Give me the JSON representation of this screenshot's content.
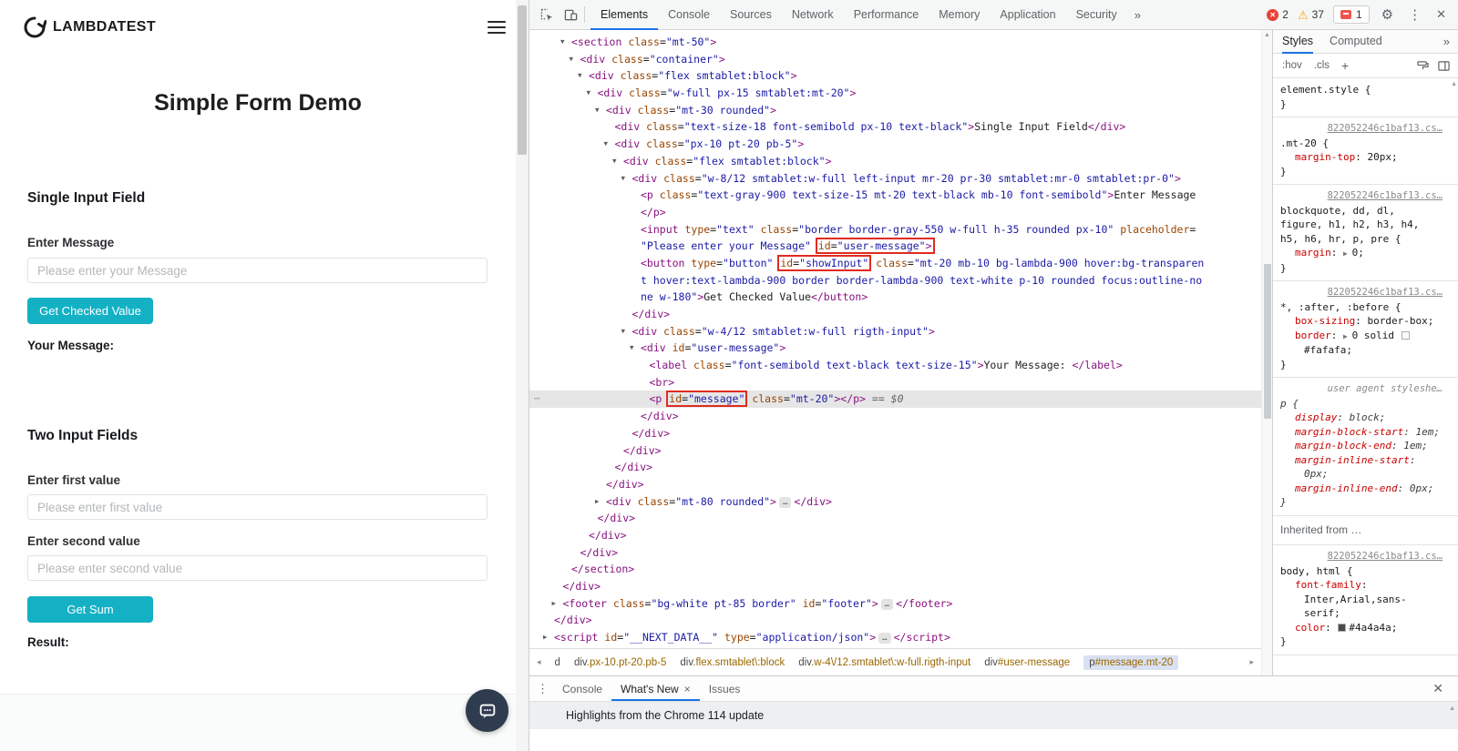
{
  "icons": {
    "gear": "⚙",
    "kebab": "⋮",
    "close": "✕",
    "more_tabs": "»",
    "crumb_left": "◂",
    "crumb_right": "▸",
    "scroll_up": "▲",
    "drawer_menu": "⋮",
    "error_x": "✕",
    "warning": "⚠"
  },
  "page": {
    "logo_text": "LAMBDATEST",
    "title": "Simple Form Demo",
    "section1": {
      "heading": "Single Input Field",
      "label": "Enter Message",
      "placeholder": "Please enter your Message",
      "button": "Get Checked Value",
      "result_label": "Your Message:"
    },
    "section2": {
      "heading": "Two Input Fields",
      "label1": "Enter first value",
      "placeholder1": "Please enter first value",
      "label2": "Enter second value",
      "placeholder2": "Please enter second value",
      "button": "Get Sum",
      "result_label": "Result:"
    }
  },
  "devtools": {
    "toolbar": {
      "tabs": [
        "Elements",
        "Console",
        "Sources",
        "Network",
        "Performance",
        "Memory",
        "Application",
        "Security"
      ],
      "selected_tab": "Elements",
      "errors": "2",
      "warnings": "37",
      "issues": "1"
    },
    "elements": {
      "rows": [
        {
          "l": 2,
          "ar": "v",
          "t": [
            [
              "<section ",
              "g"
            ],
            [
              "class",
              "a"
            ],
            [
              "=",
              "p"
            ],
            [
              "\"mt-50\"",
              "v"
            ],
            [
              ">",
              "g"
            ]
          ]
        },
        {
          "l": 3,
          "ar": "v",
          "t": [
            [
              "<div ",
              "g"
            ],
            [
              "class",
              "a"
            ],
            [
              "=",
              "p"
            ],
            [
              "\"container\"",
              "v"
            ],
            [
              ">",
              "g"
            ]
          ]
        },
        {
          "l": 4,
          "ar": "v",
          "t": [
            [
              "<div ",
              "g"
            ],
            [
              "class",
              "a"
            ],
            [
              "=",
              "p"
            ],
            [
              "\"flex smtablet:block\"",
              "v"
            ],
            [
              ">",
              "g"
            ]
          ]
        },
        {
          "l": 5,
          "ar": "v",
          "t": [
            [
              "<div ",
              "g"
            ],
            [
              "class",
              "a"
            ],
            [
              "=",
              "p"
            ],
            [
              "\"w-full px-15 smtablet:mt-20\"",
              "v"
            ],
            [
              ">",
              "g"
            ]
          ]
        },
        {
          "l": 6,
          "ar": "v",
          "t": [
            [
              "<div ",
              "g"
            ],
            [
              "class",
              "a"
            ],
            [
              "=",
              "p"
            ],
            [
              "\"mt-30 rounded\"",
              "v"
            ],
            [
              ">",
              "g"
            ]
          ]
        },
        {
          "l": 7,
          "t": [
            [
              "<div ",
              "g"
            ],
            [
              "class",
              "a"
            ],
            [
              "=",
              "p"
            ],
            [
              "\"text-size-18 font-semibold px-10 text-black\"",
              "v"
            ],
            [
              ">",
              "g"
            ],
            [
              "Single Input Field",
              "p"
            ],
            [
              "</div>",
              "g"
            ]
          ]
        },
        {
          "l": 7,
          "ar": "v",
          "t": [
            [
              "<div ",
              "g"
            ],
            [
              "class",
              "a"
            ],
            [
              "=",
              "p"
            ],
            [
              "\"px-10 pt-20 pb-5\"",
              "v"
            ],
            [
              ">",
              "g"
            ]
          ]
        },
        {
          "l": 8,
          "ar": "v",
          "t": [
            [
              "<div ",
              "g"
            ],
            [
              "class",
              "a"
            ],
            [
              "=",
              "p"
            ],
            [
              "\"flex smtablet:block\"",
              "v"
            ],
            [
              ">",
              "g"
            ]
          ]
        },
        {
          "l": 9,
          "ar": "v",
          "t": [
            [
              "<div ",
              "g"
            ],
            [
              "class",
              "a"
            ],
            [
              "=",
              "p"
            ],
            [
              "\"w-8/12 smtablet:w-full left-input mr-20 pr-30 smtablet:mr-0 smtablet:pr-0\"",
              "v"
            ],
            [
              ">",
              "g"
            ]
          ]
        },
        {
          "l": 10,
          "t": [
            [
              "<p ",
              "g"
            ],
            [
              "class",
              "a"
            ],
            [
              "=",
              "p"
            ],
            [
              "\"text-gray-900 text-size-15 mt-20 text-black mb-10 font-semibold\"",
              "v"
            ],
            [
              ">",
              "g"
            ],
            [
              "Enter Message",
              "p"
            ]
          ]
        },
        {
          "l": 10,
          "t": [
            [
              "</p>",
              "g"
            ]
          ]
        },
        {
          "l": 10,
          "t": [
            [
              "<input ",
              "g"
            ],
            [
              "type",
              "a"
            ],
            [
              "=",
              "p"
            ],
            [
              "\"text\" ",
              "v"
            ],
            [
              "class",
              "a"
            ],
            [
              "=",
              "p"
            ],
            [
              "\"border border-gray-550 w-full h-35 rounded px-10\" ",
              "v"
            ],
            [
              "placeholder",
              "a"
            ],
            [
              "=",
              "p"
            ]
          ]
        },
        {
          "l": 10,
          "t": [
            [
              "\"Please enter your Message\" ",
              "v"
            ],
            {
              "b": [
                [
                  "id",
                  "a"
                ],
                [
                  "=",
                  "p"
                ],
                [
                  "\"user-message\"",
                  "v"
                ],
                [
                  ">",
                  "g"
                ]
              ]
            }
          ]
        },
        {
          "l": 10,
          "t": [
            [
              "<button ",
              "g"
            ],
            [
              "type",
              "a"
            ],
            [
              "=",
              "p"
            ],
            [
              "\"button\" ",
              "v"
            ],
            {
              "b": [
                [
                  "id",
                  "a"
                ],
                [
                  "=",
                  "p"
                ],
                [
                  "\"showInput\"",
                  "v"
                ]
              ]
            },
            [
              " ",
              "p"
            ],
            [
              "class",
              "a"
            ],
            [
              "=",
              "p"
            ],
            [
              "\"mt-20 mb-10 bg-lambda-900 hover:bg-transparen",
              "v"
            ]
          ]
        },
        {
          "l": 10,
          "t": [
            [
              "t hover:text-lambda-900 border border-lambda-900 text-white p-10 rounded focus:outline-no",
              "v"
            ]
          ]
        },
        {
          "l": 10,
          "t": [
            [
              "ne w-180\"",
              "v"
            ],
            [
              ">",
              "g"
            ],
            [
              "Get Checked Value",
              "p"
            ],
            [
              "</button>",
              "g"
            ]
          ]
        },
        {
          "l": 9,
          "t": [
            [
              "</div>",
              "g"
            ]
          ]
        },
        {
          "l": 9,
          "ar": "v",
          "t": [
            [
              "<div ",
              "g"
            ],
            [
              "class",
              "a"
            ],
            [
              "=",
              "p"
            ],
            [
              "\"w-4/12 smtablet:w-full rigth-input\"",
              "v"
            ],
            [
              ">",
              "g"
            ]
          ]
        },
        {
          "l": 10,
          "ar": "v",
          "t": [
            [
              "<div ",
              "g"
            ],
            [
              "id",
              "a"
            ],
            [
              "=",
              "p"
            ],
            [
              "\"user-message\"",
              "v"
            ],
            [
              ">",
              "g"
            ]
          ]
        },
        {
          "l": 11,
          "t": [
            [
              "<label ",
              "g"
            ],
            [
              "class",
              "a"
            ],
            [
              "=",
              "p"
            ],
            [
              "\"font-semibold text-black text-size-15\"",
              "v"
            ],
            [
              ">",
              "g"
            ],
            [
              "Your Message: ",
              "p"
            ],
            [
              "</label>",
              "g"
            ]
          ]
        },
        {
          "l": 11,
          "t": [
            [
              "<br>",
              "g"
            ]
          ]
        },
        {
          "l": 11,
          "sel": 1,
          "t": [
            [
              "<p ",
              "g"
            ],
            {
              "b": [
                [
                  "id",
                  "a"
                ],
                [
                  "=",
                  "p"
                ],
                [
                  "\"message\"",
                  "v"
                ]
              ]
            },
            [
              " ",
              "p"
            ],
            [
              "class",
              "a"
            ],
            [
              "=",
              "p"
            ],
            [
              "\"mt-20\"",
              "v"
            ],
            [
              "></p>",
              "g"
            ],
            [
              " == $0",
              "d"
            ]
          ]
        },
        {
          "l": 10,
          "t": [
            [
              "</div>",
              "g"
            ]
          ]
        },
        {
          "l": 9,
          "t": [
            [
              "</div>",
              "g"
            ]
          ]
        },
        {
          "l": 8,
          "t": [
            [
              "</div>",
              "g"
            ]
          ]
        },
        {
          "l": 7,
          "t": [
            [
              "</div>",
              "g"
            ]
          ]
        },
        {
          "l": 6,
          "t": [
            [
              "</div>",
              "g"
            ]
          ]
        },
        {
          "l": 6,
          "ar": "r",
          "t": [
            [
              "<div ",
              "g"
            ],
            [
              "class",
              "a"
            ],
            [
              "=",
              "p"
            ],
            [
              "\"mt-80 rounded\"",
              "v"
            ],
            [
              ">",
              "g"
            ],
            [
              "…",
              "e"
            ],
            [
              "</div>",
              "g"
            ]
          ]
        },
        {
          "l": 5,
          "t": [
            [
              "</div>",
              "g"
            ]
          ]
        },
        {
          "l": 4,
          "t": [
            [
              "</div>",
              "g"
            ]
          ]
        },
        {
          "l": 3,
          "t": [
            [
              "</div>",
              "g"
            ]
          ]
        },
        {
          "l": 2,
          "t": [
            [
              "</section>",
              "g"
            ]
          ]
        },
        {
          "l": 1,
          "t": [
            [
              "</div>",
              "g"
            ]
          ]
        },
        {
          "l": 1,
          "ar": "r",
          "t": [
            [
              "<footer ",
              "g"
            ],
            [
              "class",
              "a"
            ],
            [
              "=",
              "p"
            ],
            [
              "\"bg-white pt-85 border\" ",
              "v"
            ],
            [
              "id",
              "a"
            ],
            [
              "=",
              "p"
            ],
            [
              "\"footer\"",
              "v"
            ],
            [
              ">",
              "g"
            ],
            [
              "…",
              "e"
            ],
            [
              "</footer>",
              "g"
            ]
          ]
        },
        {
          "l": 0,
          "t": [
            [
              "</div>",
              "g"
            ]
          ]
        },
        {
          "l": 0,
          "ar": "r",
          "t": [
            [
              "<script ",
              "g"
            ],
            [
              "id",
              "a"
            ],
            [
              "=",
              "p"
            ],
            [
              "\"__NEXT_DATA__\" ",
              "v"
            ],
            [
              "type",
              "a"
            ],
            [
              "=",
              "p"
            ],
            [
              "\"application/json\"",
              "v"
            ],
            [
              ">",
              "g"
            ],
            [
              "…",
              "e"
            ],
            [
              "</script>",
              "g"
            ]
          ]
        }
      ]
    },
    "breadcrumbs": {
      "items": [
        {
          "tag": "d",
          "suffix": ""
        },
        {
          "tag": "div",
          "suffix": ".px-10.pt-20.pb-5"
        },
        {
          "tag": "div",
          "suffix": ".flex.smtablet\\:block"
        },
        {
          "tag": "div",
          "suffix": ".w-4\\/12.smtablet\\:w-full.rigth-input"
        },
        {
          "tag": "div",
          "suffix": "#user-message"
        },
        {
          "tag": "p",
          "suffix": "#message.mt-20",
          "selected": true
        }
      ]
    },
    "styles": {
      "tabs": [
        "Styles",
        "Computed"
      ],
      "selected_tab": "Styles",
      "toolbar": {
        "hov": ":hov",
        "cls": ".cls",
        "add": "+"
      },
      "sections": [
        {
          "selector": "element.style",
          "props": []
        },
        {
          "link": "822052246c1baf13.cs…",
          "selector": ".mt-20",
          "props": [
            {
              "n": "margin-top",
              "v": "20px"
            }
          ]
        },
        {
          "link": "822052246c1baf13.cs…",
          "selector": "blockquote, dd, dl, figure, h1, h2, h3, h4, h5, h6, hr, p, pre",
          "props": [
            {
              "n": "margin",
              "arrow": true,
              "v": "0"
            }
          ]
        },
        {
          "link": "822052246c1baf13.cs…",
          "selector": "*, :after, :before",
          "props": [
            {
              "n": "box-sizing",
              "v": "border-box"
            },
            {
              "n": "border",
              "arrow": true,
              "pre": "0 solid ",
              "swatch": "#fafafa",
              "v": "#fafafa"
            }
          ]
        },
        {
          "link": "user agent styleshe…",
          "ua": true,
          "selector": "p",
          "props": [
            {
              "n": "display",
              "v": "block"
            },
            {
              "n": "margin-block-start",
              "v": "1em"
            },
            {
              "n": "margin-block-end",
              "v": "1em"
            },
            {
              "n": "margin-inline-start",
              "v": "0px"
            },
            {
              "n": "margin-inline-end",
              "v": "0px"
            }
          ]
        },
        {
          "header": "Inherited from …"
        },
        {
          "link": "822052246c1baf13.cs…",
          "selector": "body, html",
          "props": [
            {
              "n": "font-family",
              "v": "Inter,Arial,sans-serif"
            },
            {
              "n": "color",
              "swatch": "#4a4a4a",
              "v": "#4a4a4a"
            }
          ]
        }
      ]
    },
    "drawer": {
      "tabs": [
        {
          "label": "Console"
        },
        {
          "label": "What's New",
          "selected": true,
          "closable": true
        },
        {
          "label": "Issues"
        }
      ],
      "content": "Highlights from the Chrome 114 update"
    }
  }
}
